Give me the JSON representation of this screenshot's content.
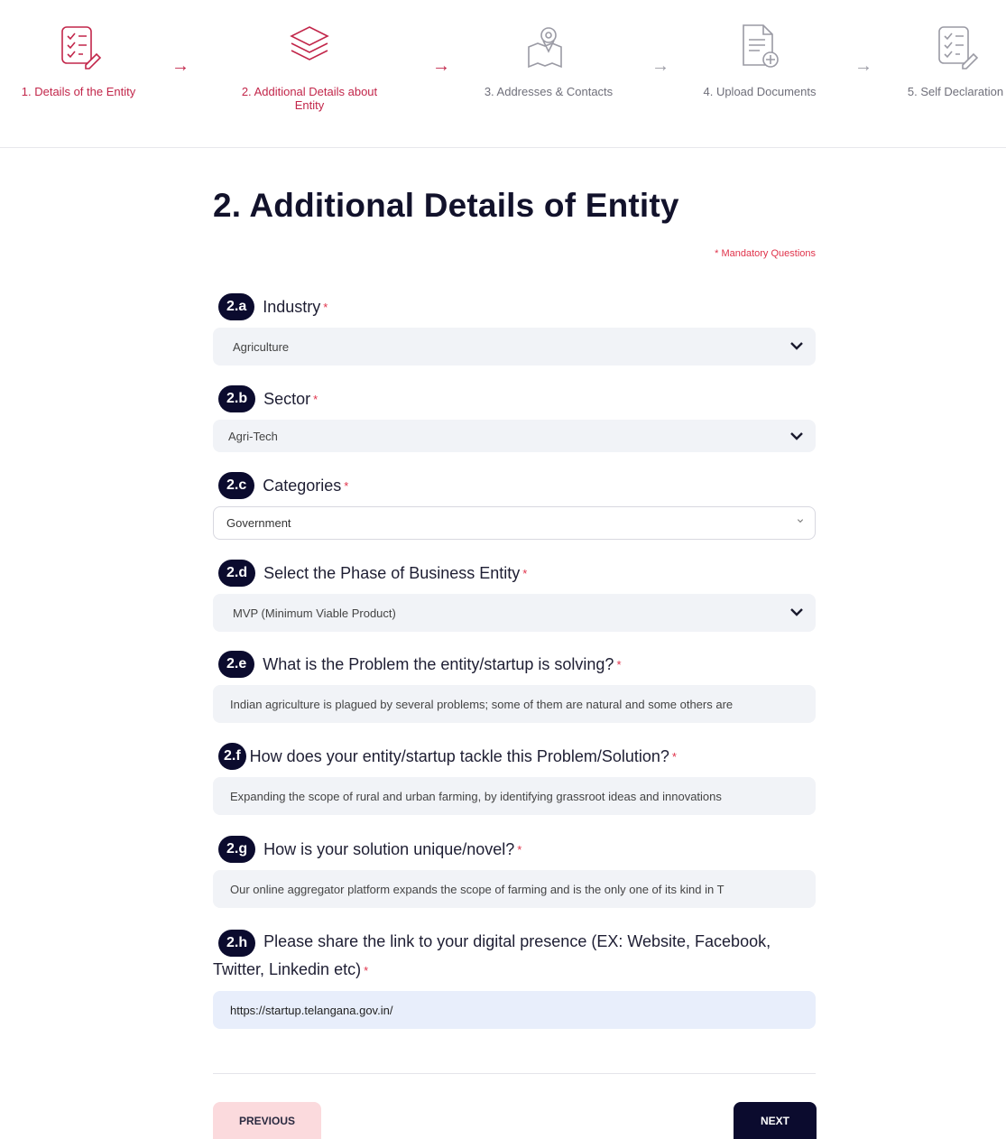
{
  "stepper": {
    "steps": [
      {
        "label": "1. Details of the Entity",
        "state": "done",
        "icon": "checklist-edit-icon"
      },
      {
        "label": "2. Additional Details about Entity",
        "state": "active",
        "icon": "layers-icon"
      },
      {
        "label": "3. Addresses & Contacts",
        "state": "todo",
        "icon": "map-pin-icon"
      },
      {
        "label": "4. Upload Documents",
        "state": "todo",
        "icon": "document-add-icon"
      },
      {
        "label": "5. Self Declaration",
        "state": "todo",
        "icon": "checklist-edit-icon"
      }
    ],
    "arrow_glyph": "→"
  },
  "page": {
    "title": "2. Additional Details of Entity",
    "mandatory_note": "* Mandatory Questions"
  },
  "questions": {
    "a": {
      "badge": "2.a",
      "label": "Industry",
      "star": "*",
      "value": "Agriculture"
    },
    "b": {
      "badge": "2.b",
      "label": "Sector",
      "star": "*",
      "value": "Agri-Tech"
    },
    "c": {
      "badge": "2.c",
      "label": "Categories",
      "star": "*",
      "value": "Government"
    },
    "d": {
      "badge": "2.d",
      "label": "Select the Phase of Business Entity",
      "star": "*",
      "value": "MVP (Minimum Viable Product)"
    },
    "e": {
      "badge": "2.e",
      "label": "What is the Problem the entity/startup is solving?",
      "star": "*",
      "value": "Indian agriculture is plagued by several problems; some of them are natural and some others are"
    },
    "f": {
      "badge": "2.f",
      "label": "How does your entity/startup tackle this Problem/Solution?",
      "star": "*",
      "value": "Expanding the scope of rural and urban farming, by identifying grassroot ideas and innovations"
    },
    "g": {
      "badge": "2.g",
      "label": "How is your solution unique/novel?",
      "star": "*",
      "value": "Our online aggregator platform expands the scope of farming and is the only one of its kind in T"
    },
    "h": {
      "badge": "2.h",
      "label": "Please share the link to your digital presence (EX: Website, Facebook, Twitter, Linkedin etc)",
      "star": "*",
      "value": "https://startup.telangana.gov.in/"
    }
  },
  "buttons": {
    "previous": "PREVIOUS",
    "next": "NEXT"
  },
  "colors": {
    "accent": "#c2264a",
    "navy": "#0b0b2e",
    "field_bg": "#f1f3f7",
    "prev_bg": "#fbdadd"
  }
}
